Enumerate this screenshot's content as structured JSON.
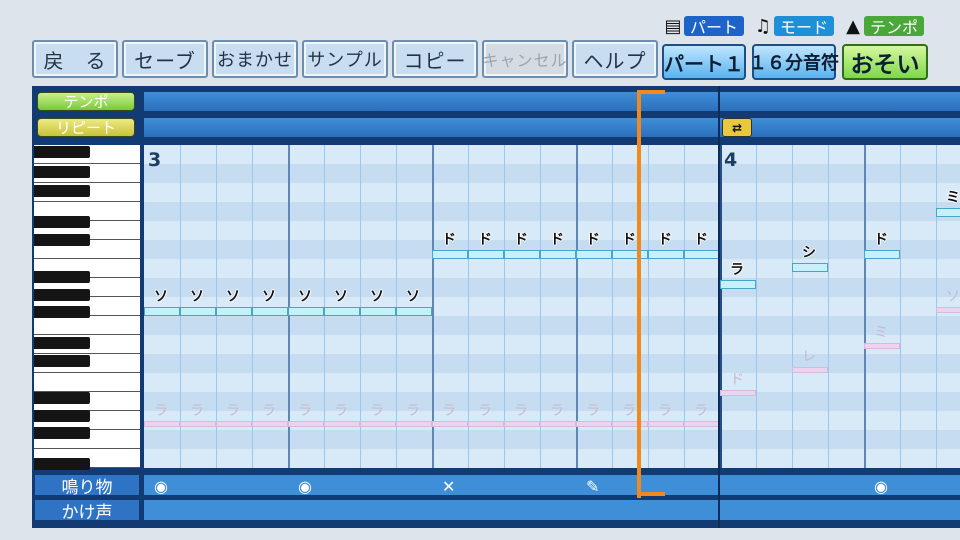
{
  "toolbar": {
    "buttons": [
      {
        "label": "戻　る",
        "disabled": false
      },
      {
        "label": "セーブ",
        "disabled": false
      },
      {
        "label": "おまかせ",
        "disabled": false
      },
      {
        "label": "サンプル",
        "disabled": false
      },
      {
        "label": "コピー",
        "disabled": false
      },
      {
        "label": "キャンセル",
        "disabled": true
      },
      {
        "label": "ヘルプ",
        "disabled": false
      }
    ]
  },
  "selectors": {
    "part": {
      "tag": "パート",
      "value": "パート１",
      "icon": "score-icon"
    },
    "mode": {
      "tag": "モード",
      "value": "１６分音符",
      "icon": "music-note-icon"
    },
    "tempo": {
      "tag": "テンポ",
      "value": "おそい",
      "icon": "metronome-icon"
    }
  },
  "colors": {
    "part_tag": "#1e64c8",
    "mode_tag": "#1e90d8",
    "tempo_tag": "#4aa83a",
    "tempo_label": "#8fd64a",
    "repeat_label": "#c8c23a",
    "playhead": "#f08a1c"
  },
  "editor": {
    "tempo_label": "テンポ",
    "repeat_label": "リピート",
    "repeat_marker_icon": "repeat-icon",
    "measures": [
      "3",
      "4"
    ],
    "notes": [
      {
        "label": "ソ",
        "row": 8.5,
        "col": 0,
        "ghost": false
      },
      {
        "label": "ソ",
        "row": 8.5,
        "col": 1,
        "ghost": false
      },
      {
        "label": "ソ",
        "row": 8.5,
        "col": 2,
        "ghost": false
      },
      {
        "label": "ソ",
        "row": 8.5,
        "col": 3,
        "ghost": false
      },
      {
        "label": "ソ",
        "row": 8.5,
        "col": 4,
        "ghost": false
      },
      {
        "label": "ソ",
        "row": 8.5,
        "col": 5,
        "ghost": false
      },
      {
        "label": "ソ",
        "row": 8.5,
        "col": 6,
        "ghost": false
      },
      {
        "label": "ソ",
        "row": 8.5,
        "col": 7,
        "ghost": false
      },
      {
        "label": "ド",
        "row": 5.5,
        "col": 8,
        "ghost": false
      },
      {
        "label": "ド",
        "row": 5.5,
        "col": 9,
        "ghost": false
      },
      {
        "label": "ド",
        "row": 5.5,
        "col": 10,
        "ghost": false
      },
      {
        "label": "ド",
        "row": 5.5,
        "col": 11,
        "ghost": false
      },
      {
        "label": "ド",
        "row": 5.5,
        "col": 12,
        "ghost": false
      },
      {
        "label": "ド",
        "row": 5.5,
        "col": 13,
        "ghost": false
      },
      {
        "label": "ド",
        "row": 5.5,
        "col": 14,
        "ghost": false
      },
      {
        "label": "ド",
        "row": 5.5,
        "col": 15,
        "ghost": false
      },
      {
        "label": "ラ",
        "row": 7.1,
        "col": 16,
        "ghost": false
      },
      {
        "label": "シ",
        "row": 6.2,
        "col": 18,
        "ghost": false
      },
      {
        "label": "ド",
        "row": 5.5,
        "col": 20,
        "ghost": false
      },
      {
        "label": "ミ",
        "row": 3.3,
        "col": 22,
        "ghost": false
      },
      {
        "label": "ラ",
        "row": 14.5,
        "col": 0,
        "ghost": true
      },
      {
        "label": "ラ",
        "row": 14.5,
        "col": 1,
        "ghost": true
      },
      {
        "label": "ラ",
        "row": 14.5,
        "col": 2,
        "ghost": true
      },
      {
        "label": "ラ",
        "row": 14.5,
        "col": 3,
        "ghost": true
      },
      {
        "label": "ラ",
        "row": 14.5,
        "col": 4,
        "ghost": true
      },
      {
        "label": "ラ",
        "row": 14.5,
        "col": 5,
        "ghost": true
      },
      {
        "label": "ラ",
        "row": 14.5,
        "col": 6,
        "ghost": true
      },
      {
        "label": "ラ",
        "row": 14.5,
        "col": 7,
        "ghost": true
      },
      {
        "label": "ラ",
        "row": 14.5,
        "col": 8,
        "ghost": true
      },
      {
        "label": "ラ",
        "row": 14.5,
        "col": 9,
        "ghost": true
      },
      {
        "label": "ラ",
        "row": 14.5,
        "col": 10,
        "ghost": true
      },
      {
        "label": "ラ",
        "row": 14.5,
        "col": 11,
        "ghost": true
      },
      {
        "label": "ラ",
        "row": 14.5,
        "col": 12,
        "ghost": true
      },
      {
        "label": "ラ",
        "row": 14.5,
        "col": 13,
        "ghost": true
      },
      {
        "label": "ラ",
        "row": 14.5,
        "col": 14,
        "ghost": true
      },
      {
        "label": "ラ",
        "row": 14.5,
        "col": 15,
        "ghost": true
      },
      {
        "label": "ド",
        "row": 12.9,
        "col": 16,
        "ghost": true
      },
      {
        "label": "レ",
        "row": 11.7,
        "col": 18,
        "ghost": true
      },
      {
        "label": "ミ",
        "row": 10.4,
        "col": 20,
        "ghost": true
      },
      {
        "label": "ソ",
        "row": 8.5,
        "col": 22,
        "ghost": true
      }
    ],
    "percussion_label": "鳴り物",
    "voice_label": "かけ声",
    "percussion_hits": [
      {
        "icon": "drum-icon",
        "col": 0
      },
      {
        "icon": "drum-icon",
        "col": 4
      },
      {
        "icon": "drumsticks-icon",
        "col": 8
      },
      {
        "icon": "whistle-icon",
        "col": 12
      },
      {
        "icon": "drum-icon",
        "col": 20
      }
    ]
  }
}
